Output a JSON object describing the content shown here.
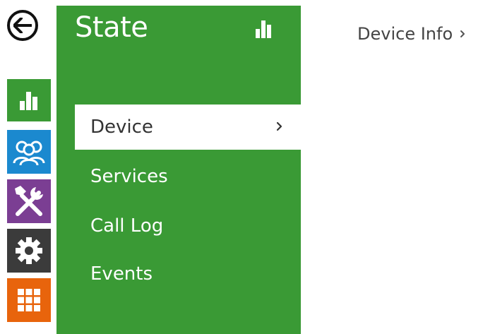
{
  "panel": {
    "title": "State",
    "menu": [
      {
        "label": "Device",
        "active": true
      },
      {
        "label": "Services",
        "active": false
      },
      {
        "label": "Call Log",
        "active": false
      },
      {
        "label": "Events",
        "active": false
      }
    ]
  },
  "breadcrumb": {
    "label": "Device Info"
  },
  "colors": {
    "state_green": "#3a9a35",
    "users_blue": "#1b89cf",
    "tools_purple": "#7b3e93",
    "settings_gray": "#3b3b3b",
    "apps_orange": "#e8640c"
  },
  "icons": {
    "back": "arrow-left-icon",
    "state": "bar-chart-icon",
    "users": "users-icon",
    "tools": "tools-icon",
    "settings": "gear-icon",
    "apps": "grid-icon",
    "menu_chevron": "chevron-right-icon"
  }
}
